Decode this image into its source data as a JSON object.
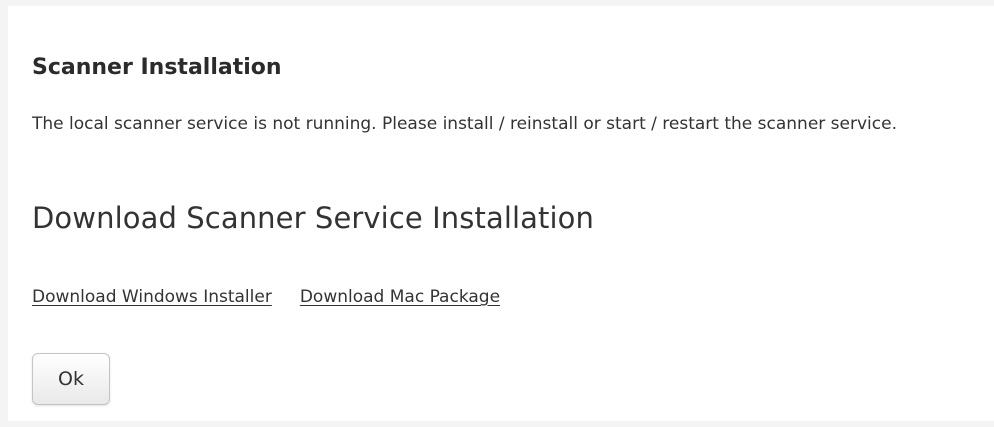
{
  "dialog": {
    "title": "Scanner Installation",
    "message": "The local scanner service is not running. Please install / reinstall or start / restart the scanner service.",
    "subheading": "Download Scanner Service Installation",
    "links": {
      "windows": "Download Windows Installer",
      "mac": "Download Mac Package"
    },
    "ok_label": "Ok"
  }
}
